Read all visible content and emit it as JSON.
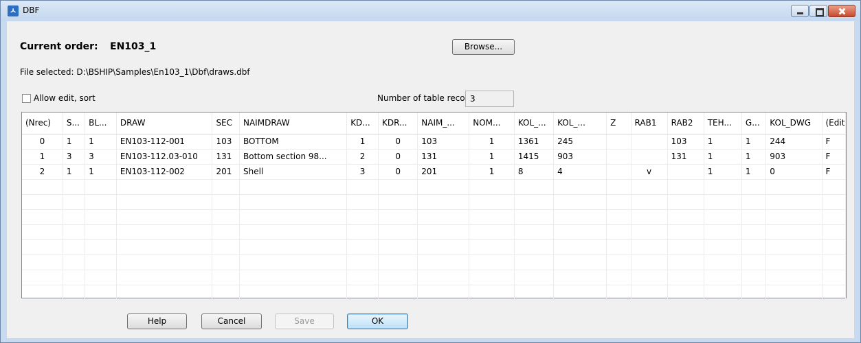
{
  "window": {
    "title": "DBF"
  },
  "order": {
    "label": "Current order:",
    "value": "EN103_1"
  },
  "browse": {
    "label": "Browse..."
  },
  "file": {
    "selected": "File selected: D:\\BSHIP\\Samples\\En103_1\\Dbf\\draws.dbf"
  },
  "allow": {
    "label": "Allow edit, sort",
    "checked": false
  },
  "records": {
    "label": "Number of table records",
    "value": "3"
  },
  "table": {
    "columns": [
      "(Nrec)",
      "S...",
      "BL...",
      "DRAW",
      "SEC",
      "NAIMDRAW",
      "KD...",
      "KDR...",
      "NAIM_...",
      "NOM...",
      "KOL_...",
      "KOL_...",
      "Z",
      "RAB1",
      "RAB2",
      "TEH...",
      "G...",
      "KOL_DWG",
      "(Edit)"
    ],
    "rows": [
      [
        "0",
        "1",
        "1",
        "EN103-112-001",
        "103",
        "BOTTOM",
        "1",
        "0",
        "103",
        "1",
        "1361",
        "245",
        "",
        "",
        "103",
        "1",
        "1",
        "244",
        "F"
      ],
      [
        "1",
        "3",
        "3",
        "EN103-112.03-010",
        "131",
        "Bottom section 98...",
        "2",
        "0",
        "131",
        "1",
        "1415",
        "903",
        "",
        "",
        "131",
        "1",
        "1",
        "903",
        "F"
      ],
      [
        "2",
        "1",
        "1",
        "EN103-112-002",
        "201",
        "Shell",
        "3",
        "0",
        "201",
        "1",
        "8",
        "4",
        "",
        "v",
        "",
        "1",
        "1",
        "0",
        "F"
      ]
    ]
  },
  "buttons": {
    "help": "Help",
    "cancel": "Cancel",
    "save": "Save",
    "ok": "OK"
  }
}
